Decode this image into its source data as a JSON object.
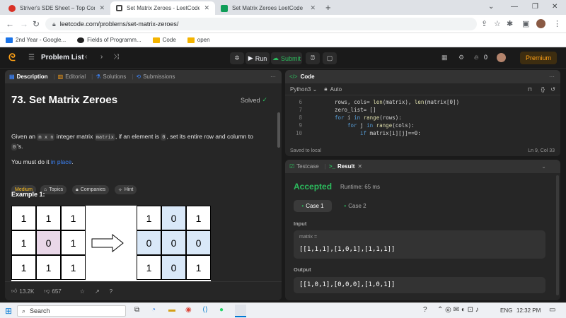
{
  "browser": {
    "tabs": [
      {
        "title": "Striver's SDE Sheet – Top Coding",
        "icon": "takeuforward-icon",
        "active": false
      },
      {
        "title": "Set Matrix Zeroes - LeetCode",
        "icon": "leetcode-icon",
        "active": true
      },
      {
        "title": "Set Matrix Zeroes LeetCode",
        "icon": "web-icon",
        "active": false
      }
    ],
    "url": "leetcode.com/problems/set-matrix-zeroes/",
    "bookmarks": [
      "2nd Year - Google...",
      "Fields of Programm...",
      "Code",
      "open"
    ]
  },
  "topnav": {
    "problem_list": "Problem List",
    "run": "Run",
    "submit": "Submit",
    "streak": "0",
    "premium": "Premium"
  },
  "left": {
    "tabs": [
      "Description",
      "Editorial",
      "Solutions",
      "Submissions"
    ],
    "title": "73. Set Matrix Zeroes",
    "solved": "Solved",
    "tags": [
      "Medium",
      "Topics",
      "Companies",
      "Hint"
    ],
    "desc": {
      "p1a": "Given an ",
      "p1code1": "m x n",
      "p1b": " integer matrix ",
      "p1code2": "matrix",
      "p1c": ", if an element is ",
      "p1code3": "0",
      "p1d": ", set its entire row and column to",
      "p1code4": "0",
      "p1e": "'s.",
      "p2a": "You must do it ",
      "p2link": "in place",
      "p2b": "."
    },
    "example": "Example 1:",
    "input_grid": [
      [
        "1",
        "1",
        "1"
      ],
      [
        "1",
        "0",
        "1"
      ],
      [
        "1",
        "1",
        "1"
      ]
    ],
    "output_grid": [
      [
        "1",
        "0",
        "1"
      ],
      [
        "0",
        "0",
        "0"
      ],
      [
        "1",
        "0",
        "1"
      ]
    ],
    "likes": "13.2K",
    "dislikes": "657"
  },
  "code": {
    "title": "Code",
    "lang": "Python3",
    "auto": "Auto",
    "lines": [
      {
        "n": "6",
        "text": "rows, cols= len(matrix), len(matrix[0])",
        "indent": 0
      },
      {
        "n": "7",
        "text": "zero_list= []",
        "indent": 0
      },
      {
        "n": "8",
        "text": "for i in range(rows):",
        "indent": 0
      },
      {
        "n": "9",
        "text": "for j in range(cols):",
        "indent": 1
      },
      {
        "n": "10",
        "text": "if matrix[i][j]==0:",
        "indent": 2
      }
    ],
    "saved": "Saved to local",
    "cursor": "Ln 9, Col 33"
  },
  "result": {
    "tabs": [
      "Testcase",
      "Result"
    ],
    "status": "Accepted",
    "runtime": "Runtime: 65 ms",
    "cases": [
      "Case 1",
      "Case 2"
    ],
    "input_label": "Input",
    "var": "matrix =",
    "input_val": "[[1,1,1],[1,0,1],[1,1,1]]",
    "output_label": "Output",
    "output_val": "[[1,0,1],[0,0,0],[1,0,1]]"
  },
  "taskbar": {
    "search": "Search",
    "lang": "ENG",
    "time": "12:32 PM"
  },
  "colors": {
    "accepted": "#2cbb5d",
    "medium": "#ffc01e",
    "link": "#3b82f6",
    "premium": "#ffa116"
  }
}
